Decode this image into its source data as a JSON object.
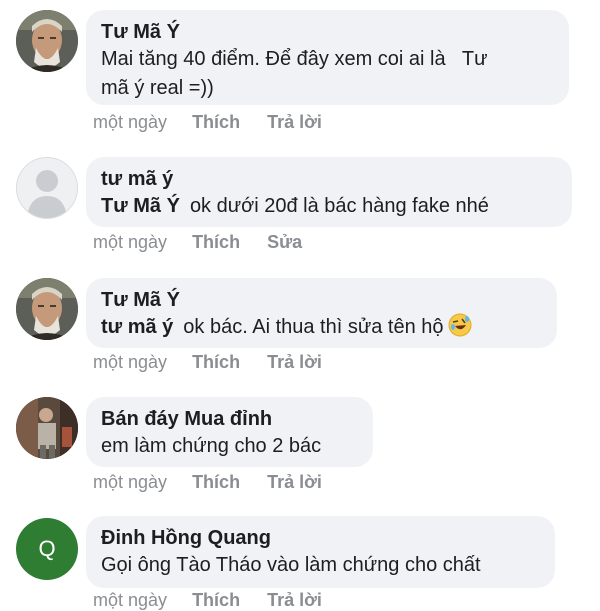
{
  "comments": [
    {
      "author": "Tư Mã Ý",
      "mention": "",
      "text_line1": "Mai tăng 40 điểm. Để đây xem coi ai là   Tư",
      "text_line2": "mã ý real =))",
      "time": "một ngày",
      "like": "Thích",
      "action": "Trả lời",
      "avatar": "portrait-old-man-icon"
    },
    {
      "author": "tư mã ý",
      "mention": "Tư Mã Ý",
      "text_line1": "ok dưới 20đ là bác hàng fake nhé",
      "time": "một ngày",
      "like": "Thích",
      "action": "Sửa",
      "avatar": "default-user-silhouette-icon"
    },
    {
      "author": "Tư Mã Ý",
      "mention": "tư mã ý",
      "text_line1": "ok bác. Ai thua thì sửa tên hộ",
      "emoji": "rolling-on-floor-laughing-emoji",
      "time": "một ngày",
      "like": "Thích",
      "action": "Trả lời",
      "avatar": "portrait-old-man-icon"
    },
    {
      "author": "Bán đáy Mua đỉnh",
      "mention": "",
      "text_line1": "em làm chứng cho 2 bác",
      "time": "một ngày",
      "like": "Thích",
      "action": "Trả lời",
      "avatar": "photo-person-icon"
    },
    {
      "author": "Đinh Hồng Quang",
      "mention": "",
      "text_line1": "Gọi ông Tào Tháo vào làm chứng cho chất",
      "time": "một ngày",
      "like": "Thích",
      "action": "Trả lời",
      "avatar": "letter-avatar",
      "avatar_letter": "Q",
      "avatar_color": "#2e7d32"
    }
  ],
  "colors": {
    "bubble": "#f0f2f5",
    "text": "#1c1e21",
    "meta": "#8a8d91"
  }
}
